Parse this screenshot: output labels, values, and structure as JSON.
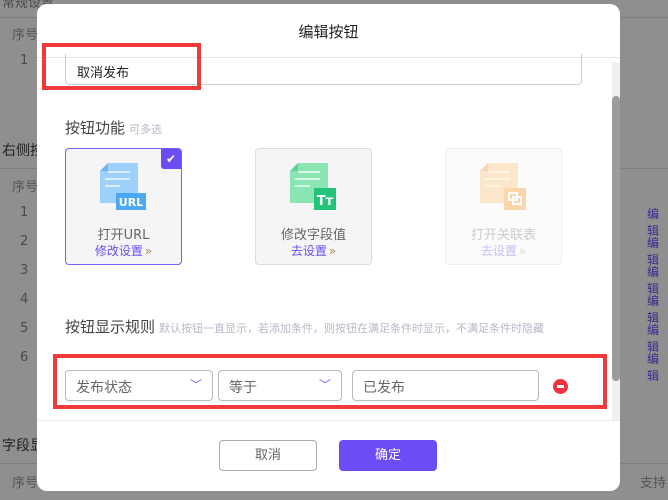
{
  "background": {
    "section1_title": "常规设置",
    "section2_title": "右侧按",
    "section3_title": "字段显",
    "col_index": "序号",
    "col_support": "支持",
    "table1_rows": [
      "1"
    ],
    "table2_rows": [
      "1",
      "2",
      "3",
      "4",
      "5",
      "6"
    ],
    "edit_link": "编辑"
  },
  "modal": {
    "title": "编辑按钮",
    "name_value": "取消发布",
    "function_section": {
      "label": "按钮功能",
      "hint": "可多选"
    },
    "cards": [
      {
        "label": "打开URL",
        "link": "修改设置",
        "badge": "URL",
        "selected": true,
        "disabled": false
      },
      {
        "label": "修改字段值",
        "link": "去设置",
        "badge": "Tт",
        "selected": false,
        "disabled": false
      },
      {
        "label": "打开关联表",
        "link": "去设置",
        "selected": false,
        "disabled": true
      }
    ],
    "rule_section": {
      "label": "按钮显示规则",
      "hint": "默认按钮一直显示，若添加条件，则按钮在满足条件时显示，不满足条件时隐藏"
    },
    "condition": {
      "field": "发布状态",
      "operator": "等于",
      "value": "已发布"
    },
    "cancel_label": "取消",
    "confirm_label": "确定"
  },
  "colors": {
    "accent": "#6c4df5",
    "highlight": "#f33a3a",
    "remove": "#f03241"
  }
}
